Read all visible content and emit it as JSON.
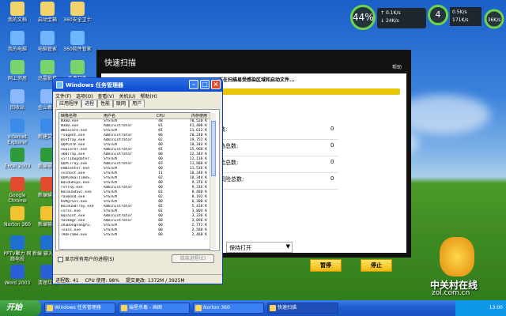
{
  "desktop_icons": [
    {
      "label": "我的文档",
      "x": "c1"
    },
    {
      "label": "我的电脑",
      "x": "c1"
    },
    {
      "label": "网上邻居",
      "x": "c1"
    },
    {
      "label": "回收站",
      "x": "c1"
    },
    {
      "label": "Internet Explorer",
      "x": "c1"
    },
    {
      "label": "Excel 2003",
      "x": "c1"
    },
    {
      "label": "Google Chrome",
      "x": "c1"
    },
    {
      "label": "Norton 360",
      "x": "c1"
    },
    {
      "label": "PPTV聚力 网络电视",
      "x": "c1"
    },
    {
      "label": "Word 2003",
      "x": "c1"
    },
    {
      "label": "启动宝箱",
      "x": "c2"
    },
    {
      "label": "电脑管家",
      "x": "c2"
    },
    {
      "label": "迅雷影音",
      "x": "c2"
    },
    {
      "label": "金山毒霸",
      "x": "c2"
    },
    {
      "label": "新建文本",
      "x": "c2"
    },
    {
      "label": "新编输入",
      "x": "c2"
    },
    {
      "label": "新编输入",
      "x": "c2"
    },
    {
      "label": "新编输入",
      "x": "c2"
    },
    {
      "label": "新编 输入管理",
      "x": "c2"
    },
    {
      "label": "清理垃圾",
      "x": "c2"
    },
    {
      "label": "360安全卫士",
      "x": "c3"
    },
    {
      "label": "360软件管家",
      "x": "c3"
    },
    {
      "label": "杀毒软件",
      "x": "c3"
    }
  ],
  "gadget": {
    "cpu_percent": "44%",
    "net_up": "0.1K/s",
    "net_down": "24K/s",
    "cpu_small": "4",
    "mem_used": "0.5K/s",
    "mem_val": "171K/s",
    "mem2": "36K/s",
    "net_dot": "0"
  },
  "scan": {
    "title": "快速扫描",
    "help": "帮助",
    "status": "正在扫描易受感染区域和启动文件...",
    "stats": [
      {
        "label": "数:",
        "value": "0"
      },
      {
        "label": "胁总数:",
        "value": "0"
      },
      {
        "label": "险总数:",
        "value": "0"
      },
      {
        "label": "风险总数:",
        "value": "0"
      }
    ],
    "select_value": "保持打开",
    "pause": "暂停",
    "stop": "停止"
  },
  "taskmgr": {
    "title": "Windows 任务管理器",
    "menu": [
      "文件(F)",
      "选项(O)",
      "查看(V)",
      "关机(U)",
      "帮助(H)"
    ],
    "tabs": [
      "应用程序",
      "进程",
      "性能",
      "联网",
      "用户"
    ],
    "columns": [
      "映像名称",
      "用户名",
      "CPU",
      "内存使用"
    ],
    "rows": [
      [
        "N360.exe",
        "SYSTEM",
        "48",
        "70,520 K"
      ],
      [
        "N360.exe",
        "Administrator",
        "01",
        "41,408 K"
      ],
      [
        "Wbescore.exe",
        "SYSTEM",
        "01",
        "21,612 K"
      ],
      [
        "rsagent.exe",
        "Administrator",
        "06",
        "20,240 K"
      ],
      [
        "Rsetray.exe",
        "Administrator",
        "02",
        "19,752 K"
      ],
      [
        "QQPCRTP.exe",
        "SYSTEM",
        "00",
        "18,344 K"
      ],
      [
        "explorer.exe",
        "Administrator",
        "01",
        "15,960 K"
      ],
      [
        "360Tray.exe",
        "Administrator",
        "00",
        "12,344 K"
      ],
      [
        "virlibupdater.",
        "SYSTEM",
        "00",
        "12,136 K"
      ],
      [
        "QQPCTray.exe",
        "Administrator",
        "03",
        "11,988 K"
      ],
      [
        "kmbcenter.exe",
        "SYSTEM",
        "00",
        "11,536 K"
      ],
      [
        "svchost.exe",
        "SYSTEM",
        "11",
        "10,348 K"
      ],
      [
        "QQPCRealTimeS.",
        "SYSTEM",
        "02",
        "10,344 K"
      ],
      [
        "BaiduHips.exe",
        "SYSTEM",
        "00",
        "9,376 K"
      ],
      [
        "rstray.exe",
        "Administrator",
        "00",
        "9,316 K"
      ],
      [
        "BaiduSdSvc.exe",
        "SYSTEM",
        "01",
        "8,488 K"
      ],
      [
        "ravmond.exe",
        "SYSTEM",
        "02",
        "8,192 K"
      ],
      [
        "RsMgrSvc.exe",
        "SYSTEM",
        "00",
        "6,300 K"
      ],
      [
        "BaiduSdTray.exe",
        "Administrator",
        "02",
        "5,428 K"
      ],
      [
        "csrss.exe",
        "SYSTEM",
        "01",
        "3,804 K"
      ],
      [
        "mqsaint.exe",
        "Administrator",
        "00",
        "3,336 K"
      ],
      [
        "taskmgr.exe",
        "Administrator",
        "00",
        "3,096 K"
      ],
      [
        "ZhuDongFangYu.",
        "SYSTEM",
        "00",
        "2,772 K"
      ],
      [
        "lsass.exe",
        "SYSTEM",
        "00",
        "2,588 K"
      ],
      [
        "TAOFrame.exe",
        "SYSTEM",
        "00",
        "2,460 K"
      ]
    ],
    "show_all": "显示所有用户的进程(S)",
    "end_process": "结束进程(E)",
    "status": {
      "procs": "进程数: 41",
      "cpu": "CPU 使用: 98%",
      "commit": "提交更改: 1372M / 3925M"
    }
  },
  "taskbar": {
    "start": "开始",
    "items": [
      "Windows 任务管理器",
      "瑞星杀毒 - 画图",
      "Norton 360",
      "快速扫描"
    ],
    "clock": "13:00"
  },
  "watermark": {
    "brand": "中关村在线",
    "site": "zol.com.cn"
  },
  "colors": {
    "accent": "#f0b90c",
    "xp_blue": "#0a4ad1",
    "gadget_green": "#6bd44a"
  }
}
